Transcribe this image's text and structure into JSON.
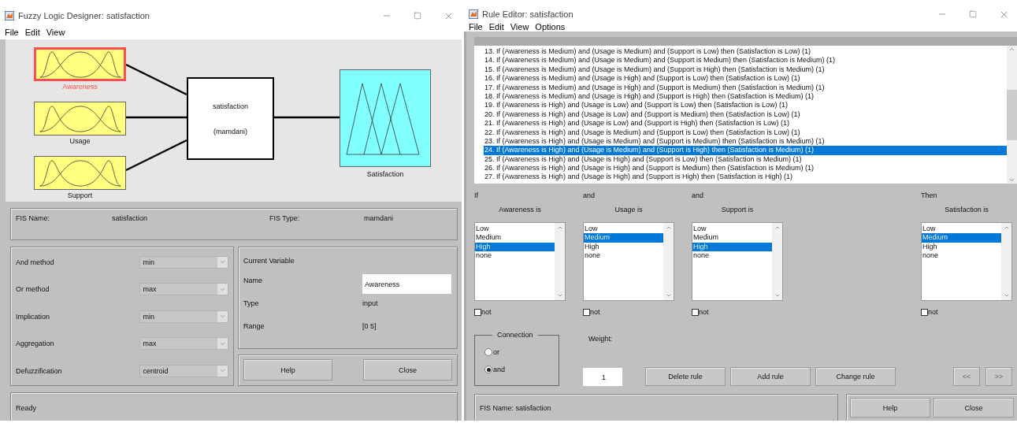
{
  "designer": {
    "title": "Fuzzy Logic Designer: satisfaction",
    "menu": [
      "File",
      "Edit",
      "View"
    ],
    "inputs": [
      {
        "name": "Awareness",
        "selected": true
      },
      {
        "name": "Usage",
        "selected": false
      },
      {
        "name": "Support",
        "selected": false
      }
    ],
    "system": {
      "name": "satisfaction",
      "type": "(mamdani)"
    },
    "output": {
      "name": "Satisfaction",
      "selected": false
    },
    "fis_name_label": "FIS Name:",
    "fis_name": "satisfaction",
    "fis_type_label": "FIS Type:",
    "fis_type": "mamdani",
    "methods": [
      {
        "label": "And method",
        "value": "min"
      },
      {
        "label": "Or method",
        "value": "max"
      },
      {
        "label": "Implication",
        "value": "min"
      },
      {
        "label": "Aggregation",
        "value": "max"
      },
      {
        "label": "Defuzzification",
        "value": "centroid"
      }
    ],
    "current_variable": {
      "title": "Current Variable",
      "name_label": "Name",
      "name": "Awareness",
      "type_label": "Type",
      "type": "input",
      "range_label": "Range",
      "range": "[0 5]"
    },
    "buttons": [
      "Help",
      "Close"
    ],
    "status": "Ready"
  },
  "rule_editor": {
    "title": "Rule Editor: satisfaction",
    "menu": [
      "File",
      "Edit",
      "View",
      "Options"
    ],
    "rules": [
      {
        "text": "13. If (Awareness is Medium) and (Usage is Medium) and (Support is Low) then (Satisfaction is Low) (1)",
        "selected": false
      },
      {
        "text": "14. If (Awareness is Medium) and (Usage is Medium) and (Support is Medium) then (Satisfaction is Medium) (1)",
        "selected": false
      },
      {
        "text": "15. If (Awareness is Medium) and (Usage is Medium) and (Support is High) then (Satisfaction is Medium) (1)",
        "selected": false
      },
      {
        "text": "16. If (Awareness is Medium) and (Usage is High) and (Support is Low) then (Satisfaction is Low) (1)",
        "selected": false
      },
      {
        "text": "17. If (Awareness is Medium) and (Usage is High) and (Support is Medium) then (Satisfaction is Medium) (1)",
        "selected": false
      },
      {
        "text": "18. If (Awareness is Medium) and (Usage is High) and (Support is High) then (Satisfaction is Medium) (1)",
        "selected": false
      },
      {
        "text": "19. If (Awareness is High) and (Usage is Low) and (Support is Low) then (Satisfaction is Low) (1)",
        "selected": false
      },
      {
        "text": "20. If (Awareness is High) and (Usage is Low) and (Support is Medium) then (Satisfaction is Low) (1)",
        "selected": false
      },
      {
        "text": "21. If (Awareness is High) and (Usage is Low) and (Support is High) then (Satisfaction is Low) (1)",
        "selected": false
      },
      {
        "text": "22. If (Awareness is High) and (Usage is Medium) and (Support is Low) then (Satisfaction is Low) (1)",
        "selected": false
      },
      {
        "text": "23. If (Awareness is High) and (Usage is Medium) and (Support is Medium) then (Satisfaction is Medium) (1)",
        "selected": false
      },
      {
        "text": "24. If (Awareness is High) and (Usage is Medium) and (Support is High) then (Satisfaction is Medium) (1)",
        "selected": true
      },
      {
        "text": "25. If (Awareness is High) and (Usage is High) and (Support is Low) then (Satisfaction is Medium) (1)",
        "selected": false
      },
      {
        "text": "26. If (Awareness is High) and (Usage is High) and (Support is Medium) then (Satisfaction is Medium) (1)",
        "selected": false
      },
      {
        "text": "27. If (Awareness is High) and (Usage is High) and (Support is High) then (Satisfaction is High) (1)",
        "selected": false
      }
    ],
    "clauses": [
      {
        "kind": "antecedent",
        "connector": "If",
        "label": "Awareness is",
        "not_label": "not",
        "not_checked": false,
        "options": [
          {
            "label": "Low",
            "selected": false
          },
          {
            "label": "Medium",
            "selected": false
          },
          {
            "label": "High",
            "selected": true
          },
          {
            "label": "none",
            "selected": false
          }
        ]
      },
      {
        "kind": "antecedent",
        "connector": "and",
        "label": "Usage is",
        "not_label": "not",
        "not_checked": false,
        "options": [
          {
            "label": "Low",
            "selected": false
          },
          {
            "label": "Medium",
            "selected": true
          },
          {
            "label": "High",
            "selected": false
          },
          {
            "label": "none",
            "selected": false
          }
        ]
      },
      {
        "kind": "antecedent",
        "connector": "and",
        "label": "Support is",
        "not_label": "not",
        "not_checked": false,
        "options": [
          {
            "label": "Low",
            "selected": false
          },
          {
            "label": "Medium",
            "selected": false
          },
          {
            "label": "High",
            "selected": true
          },
          {
            "label": "none",
            "selected": false
          }
        ]
      },
      {
        "kind": "consequent",
        "connector": "Then",
        "label": "Satisfaction is",
        "not_label": "not",
        "not_checked": false,
        "options": [
          {
            "label": "Low",
            "selected": false
          },
          {
            "label": "Medium",
            "selected": true
          },
          {
            "label": "High",
            "selected": false
          },
          {
            "label": "none",
            "selected": false
          }
        ]
      }
    ],
    "connection": {
      "title": "Connection",
      "options": [
        {
          "label": "or",
          "selected": false
        },
        {
          "label": "and",
          "selected": true
        }
      ]
    },
    "weight_label": "Weight:",
    "weight": "1",
    "buttons": [
      "Delete rule",
      "Add rule",
      "Change rule"
    ],
    "nav": [
      {
        "label": "<<",
        "disabled": true
      },
      {
        "label": ">>",
        "disabled": true
      }
    ],
    "status": "FIS Name: satisfaction",
    "footer_buttons": [
      "Help",
      "Close"
    ]
  }
}
